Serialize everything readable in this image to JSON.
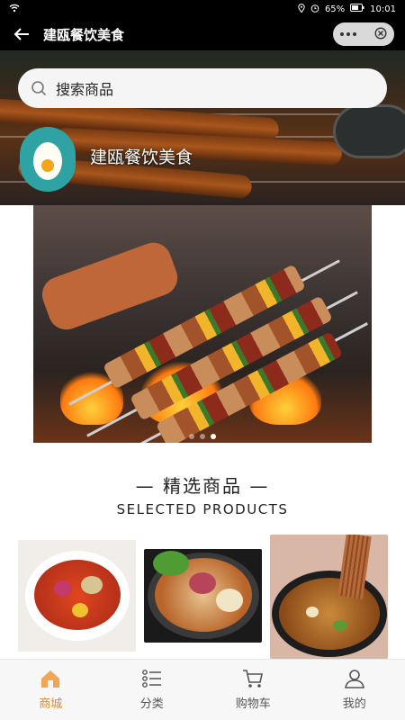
{
  "status_bar": {
    "battery": "65%",
    "time": "10:01"
  },
  "header": {
    "title": "建瓯餐饮美食"
  },
  "search": {
    "placeholder": "搜索商品"
  },
  "store": {
    "name": "建瓯餐饮美食"
  },
  "banner": {
    "page_count": 3,
    "active_index": 2
  },
  "section": {
    "title": "精选商品",
    "subtitle": "SELECTED PRODUCTS"
  },
  "tabbar": {
    "active_color": "#e08a2c",
    "items": [
      {
        "label": "商城",
        "icon": "home-icon",
        "active": true
      },
      {
        "label": "分类",
        "icon": "category-list-icon",
        "active": false
      },
      {
        "label": "购物车",
        "icon": "cart-icon",
        "active": false
      },
      {
        "label": "我的",
        "icon": "user-icon",
        "active": false
      }
    ]
  }
}
